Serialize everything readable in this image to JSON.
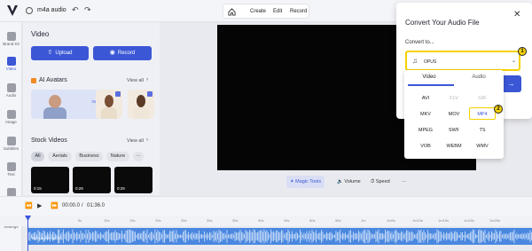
{
  "app": {
    "project_name": "m4a audio"
  },
  "topbar": {
    "menu": [
      "Create",
      "Edit",
      "Record"
    ]
  },
  "rail": {
    "items": [
      {
        "label": "Brand Kit",
        "icon": "brand-kit-icon"
      },
      {
        "label": "Video",
        "icon": "video-icon",
        "active": true
      },
      {
        "label": "Audio",
        "icon": "audio-icon"
      },
      {
        "label": "Image",
        "icon": "image-icon"
      },
      {
        "label": "Subtitles",
        "icon": "subtitles-icon"
      },
      {
        "label": "Text",
        "icon": "text-icon"
      },
      {
        "label": "Elements",
        "icon": "elements-icon"
      },
      {
        "label": "Settings",
        "icon": "settings-icon"
      }
    ]
  },
  "panel": {
    "title": "Video",
    "upload_label": "Upload",
    "record_label": "Record",
    "ai_avatars": {
      "title": "AI Avatars",
      "view_all": "View all",
      "cta": "Get your own avatar"
    },
    "stock_videos": {
      "title": "Stock Videos",
      "view_all": "View all",
      "filters": [
        "All",
        "Aerials",
        "Business",
        "Nature",
        "···"
      ],
      "thumbs": [
        "0:15",
        "0:29",
        "0:29"
      ]
    }
  },
  "canvas_tools": {
    "magic_tools": "Magic Tools",
    "volume": "Volume",
    "speed": "Speed",
    "more": "···"
  },
  "timeline": {
    "current_time": "00:00.0",
    "separator": "/",
    "total_time": "01:36.0",
    "ruler_ticks": [
      "5s",
      "10s",
      "15s",
      "20s",
      "25s",
      "30s",
      "35s",
      "40s",
      "45s",
      "50s",
      "55s",
      "1m",
      "1m5s",
      "1m10s",
      "1m15s",
      "1m20s",
      "1m25s"
    ],
    "track_label": "m4a audio audio"
  },
  "dialog": {
    "title": "Convert Your Audio File",
    "convert_to_label": "Convert to...",
    "selected_format": "OPUS",
    "tabs": [
      "Video",
      "Audio"
    ],
    "formats": [
      {
        "label": "AVI",
        "disabled": false
      },
      {
        "label": "FLV",
        "disabled": true
      },
      {
        "label": "GIF",
        "disabled": true
      },
      {
        "label": "MKV",
        "disabled": false
      },
      {
        "label": "MOV",
        "disabled": false
      },
      {
        "label": "MP4",
        "disabled": false,
        "highlight": true
      },
      {
        "label": "MPEG",
        "disabled": false
      },
      {
        "label": "SWF",
        "disabled": false
      },
      {
        "label": "TS",
        "disabled": false
      },
      {
        "label": "VOB",
        "disabled": false
      },
      {
        "label": "WEBM",
        "disabled": false
      },
      {
        "label": "WMV",
        "disabled": false
      }
    ],
    "callouts": [
      "1",
      "2"
    ]
  },
  "colors": {
    "accent": "#3b57d6",
    "callout": "#f4d100",
    "waveform": "#4a88e0"
  }
}
